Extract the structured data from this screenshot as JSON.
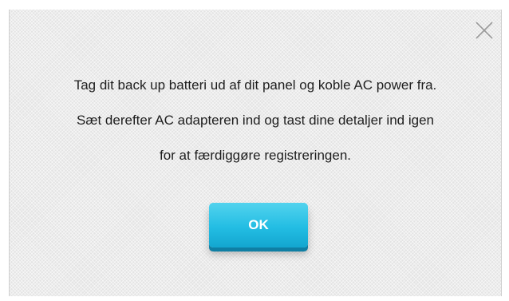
{
  "dialog": {
    "message_lines": [
      "Tag dit back up batteri ud af dit panel og koble AC power fra.",
      "Sæt derefter AC adapteren ind og tast dine detaljer ind igen",
      "for at færdiggøre registreringen."
    ],
    "ok_label": "OK",
    "close_icon": "close-icon",
    "colors": {
      "button_top": "#52d3ee",
      "button_bottom": "#13a6cf",
      "text": "#1e1e1e",
      "close": "#9a9a9a"
    }
  }
}
